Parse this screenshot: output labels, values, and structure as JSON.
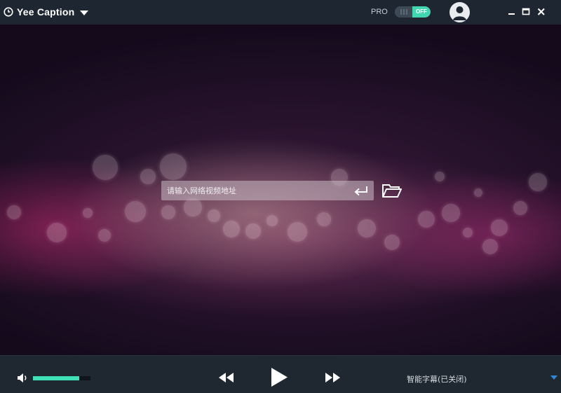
{
  "titlebar": {
    "app_title": "Yee Caption",
    "pro_label": "PRO",
    "pro_toggle_state": "OFF"
  },
  "video": {
    "url_placeholder": "请输入网络视频地址"
  },
  "player": {
    "volume_level": 0.8,
    "subtitle_status": "智能字幕(已关闭)"
  },
  "colors": {
    "accent": "#3fe0b5",
    "titlebar_bg": "#1e2731",
    "bottombar_bg": "#1f2831",
    "corner_arrow": "#2e88d6"
  },
  "icons": {
    "logo": "clock-logo-icon",
    "title_dropdown": "caret-down-icon",
    "avatar": "user-avatar-icon",
    "minimize": "minimize-icon",
    "maximize": "maximize-icon",
    "close": "close-icon",
    "enter": "enter-return-icon",
    "folder": "folder-open-icon",
    "volume": "volume-icon",
    "rewind": "rewind-icon",
    "play": "play-icon",
    "forward": "fast-forward-icon",
    "corner": "caret-down-icon"
  }
}
